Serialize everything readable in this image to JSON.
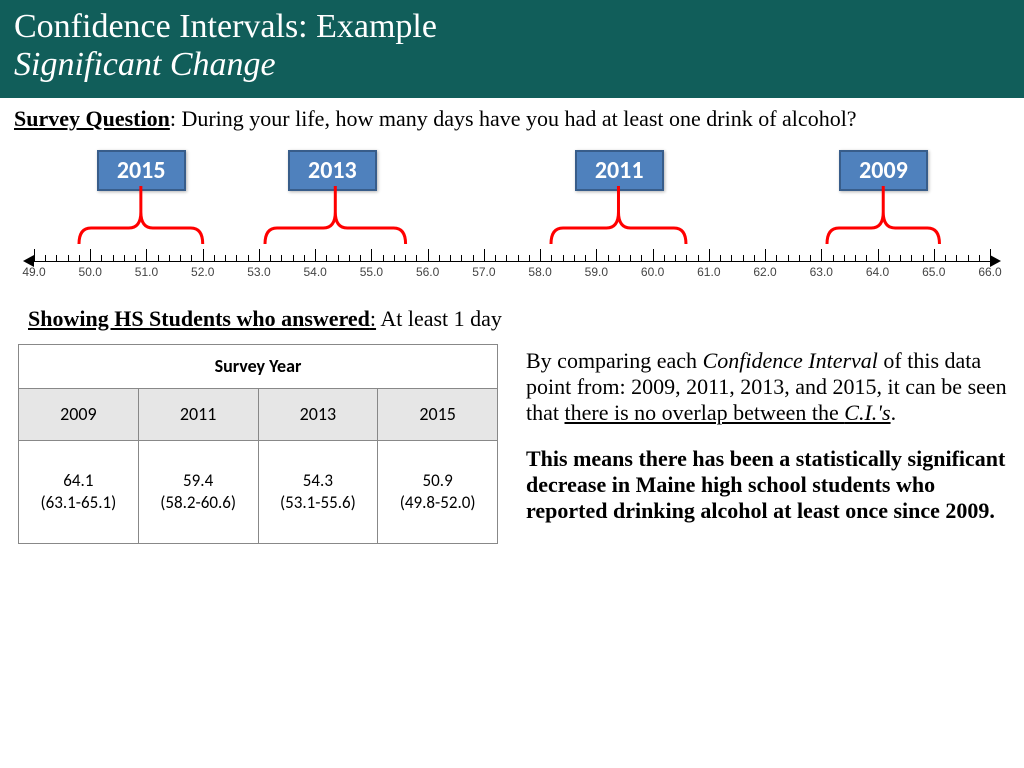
{
  "header": {
    "title": "Confidence Intervals: Example",
    "subtitle": "Significant Change"
  },
  "survey": {
    "label": "Survey Question",
    "text": ": During your life, how many days have you had at least one drink of alcohol?"
  },
  "showing": {
    "label": "Showing HS Students who answered",
    "text": ": At least 1 day"
  },
  "chart_data": {
    "type": "interval-ruler",
    "xlabel": "",
    "xlim": [
      49.0,
      66.0
    ],
    "tick_step": 1.0,
    "minor_per_major": 5,
    "intervals": [
      {
        "year": "2015",
        "lo": 49.8,
        "hi": 52.0,
        "center": 50.9
      },
      {
        "year": "2013",
        "lo": 53.1,
        "hi": 55.6,
        "center": 54.3
      },
      {
        "year": "2011",
        "lo": 58.2,
        "hi": 60.6,
        "center": 59.4
      },
      {
        "year": "2009",
        "lo": 63.1,
        "hi": 65.1,
        "center": 64.1
      }
    ]
  },
  "table": {
    "header": "Survey Year",
    "years": [
      "2009",
      "2011",
      "2013",
      "2015"
    ],
    "rows": [
      {
        "value": "64.1",
        "ci": "(63.1-65.1)"
      },
      {
        "value": "59.4",
        "ci": "(58.2-60.6)"
      },
      {
        "value": "54.3",
        "ci": "(53.1-55.6)"
      },
      {
        "value": "50.9",
        "ci": "(49.8-52.0)"
      }
    ]
  },
  "explain": {
    "p1a": "By comparing each ",
    "p1b": "Confidence Interval",
    "p1c": " of this data point from: 2009, 2011, 2013, and 2015, it can be seen that ",
    "p1d": "there is no overlap between the ",
    "p1e": "C.I.'s",
    "p1f": ".",
    "p2": "This means there has been a statistically significant decrease in Maine high school students who reported drinking alcohol at least once since 2009."
  }
}
